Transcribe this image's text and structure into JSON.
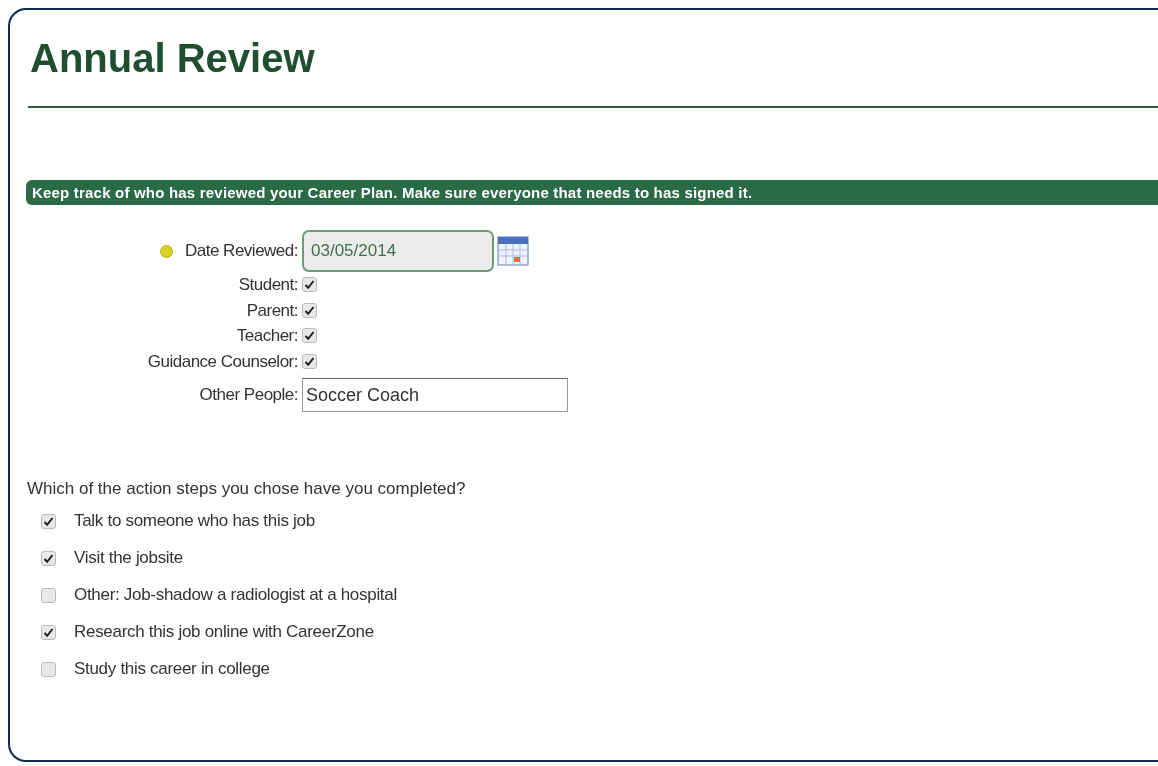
{
  "title": "Annual Review",
  "banner": "Keep track of who has reviewed your Career Plan. Make sure everyone that needs to has signed it.",
  "date_reviewed": {
    "label": "Date Reviewed:",
    "value": "03/05/2014",
    "required": true
  },
  "reviewers": [
    {
      "label": "Student:",
      "checked": true
    },
    {
      "label": "Parent:",
      "checked": true
    },
    {
      "label": "Teacher:",
      "checked": true
    },
    {
      "label": "Guidance Counselor:",
      "checked": true
    }
  ],
  "other_people": {
    "label": "Other People:",
    "value": "Soccer Coach"
  },
  "question": "Which of the action steps you chose have you completed?",
  "action_steps": [
    {
      "label": "Talk to someone who has this job",
      "checked": true
    },
    {
      "label": "Visit the jobsite",
      "checked": true
    },
    {
      "label": "Other: Job-shadow a radiologist at a hospital",
      "checked": false
    },
    {
      "label": "Research this job online with CareerZone",
      "checked": true
    },
    {
      "label": "Study this career in college",
      "checked": false
    }
  ]
}
